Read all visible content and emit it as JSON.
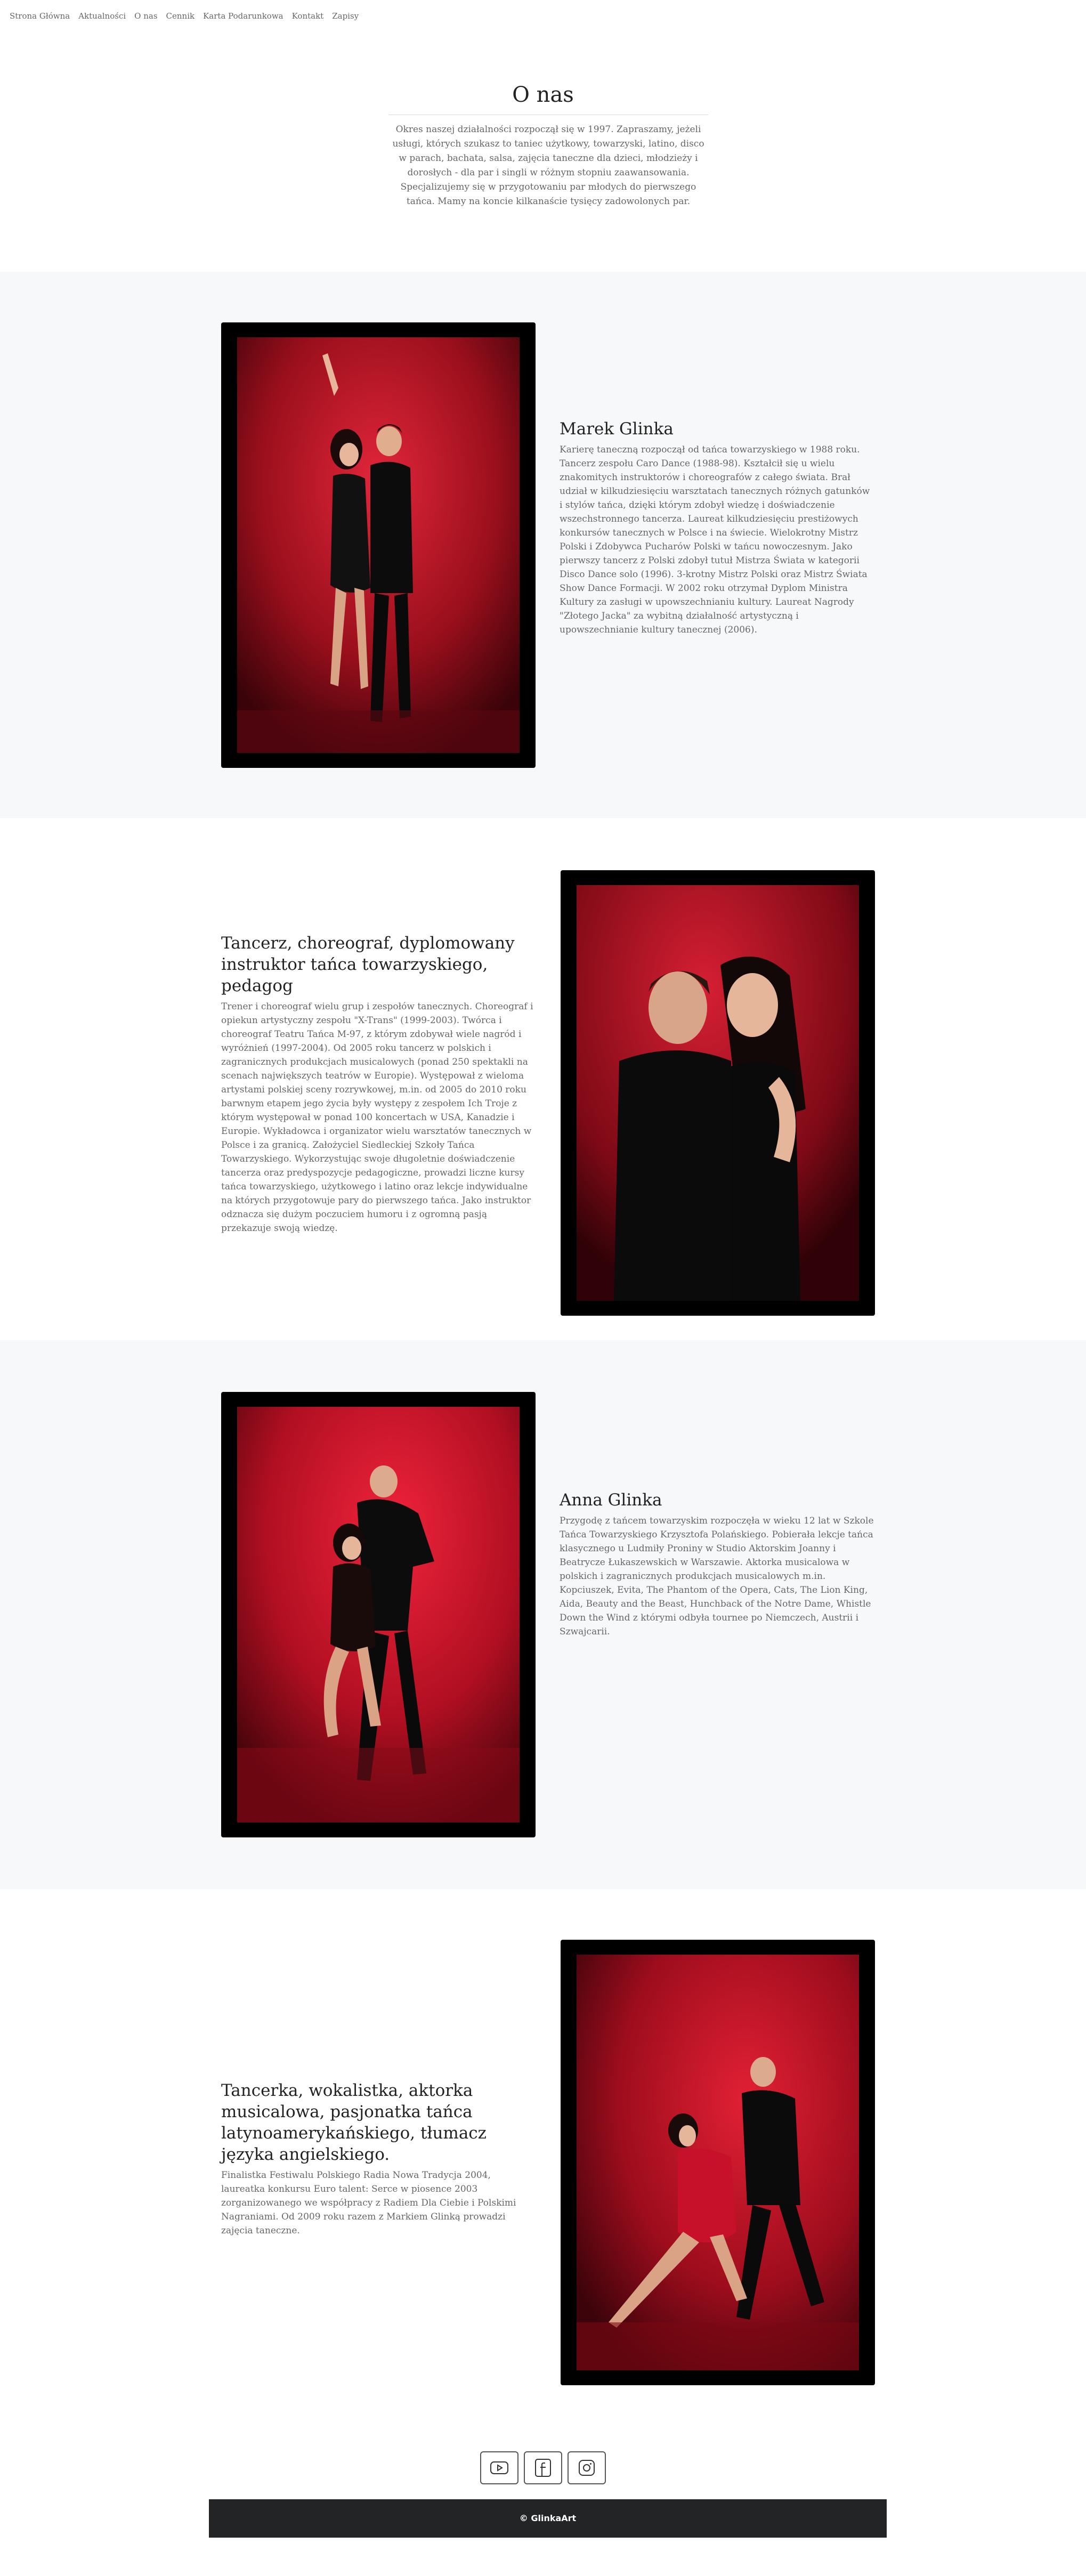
{
  "nav": {
    "items": [
      "Strona Główna",
      "Aktualności",
      "O nas",
      "Cennik",
      "Karta Podarunkowa",
      "Kontakt",
      "Zapisy"
    ]
  },
  "about": {
    "title": "O nas",
    "text": "Okres naszej działalności rozpoczął się w 1997. Zapraszamy, jeżeli usługi, których szukasz to taniec użytkowy, towarzyski, latino, disco w parach, bachata, salsa, zajęcia taneczne dla dzieci, młodzieży i dorosłych - dla par i singli w różnym stopniu zaawansowania. Specjalizujemy się w przygotowaniu par młodych do pierwszego tańca. Mamy na koncie kilkanaście tysięcy zadowolonych par."
  },
  "sections": [
    {
      "heading": "Marek Glinka",
      "text": "Karierę taneczną rozpoczął od tańca towarzyskiego w 1988 roku. Tancerz zespołu Caro Dance (1988-98). Kształcił się u wielu znakomitych instruktorów i choreografów z całego świata. Brał udział w kilkudziesięciu warsztatach tanecznych różnych gatunków i stylów tańca, dzięki którym zdobył wiedzę i doświadczenie wszechstronnego tancerza. Laureat kilkudziesięciu prestiżowych konkursów tanecznych w Polsce i na świecie. Wielokrotny Mistrz Polski i Zdobywca Pucharów Polski w tańcu nowoczesnym. Jako pierwszy tancerz z Polski zdobył tutuł Mistrza Świata w kategorii Disco Dance solo (1996). 3-krotny Mistrz Polski oraz Mistrz Świata Show Dance Formacji. W 2002 roku otrzymał Dyplom Ministra Kultury za zasługi w upowszechnianiu kultury. Laureat Nagrody \"Złotego Jacka\" za wybitną działalność artystyczną i upowszechnianie kultury tanecznej (2006)."
    },
    {
      "heading": "Tancerz, choreograf, dyplomowany instruktor tańca towarzyskiego, pedagog",
      "text": "Trener i choreograf wielu grup i zespołów tanecznych. Choreograf i opiekun artystyczny zespołu \"X-Trans\" (1999-2003). Twórca i choreograf Teatru Tańca M-97, z którym zdobywał wiele nagród i wyróżnień (1997-2004). Od 2005 roku tancerz w polskich i zagranicznych produkcjach musicalowych (ponad 250 spektakli na scenach największych teatrów w Europie). Występował z wieloma artystami polskiej sceny rozrywkowej, m.in. od 2005 do 2010 roku barwnym etapem jego życia były występy z zespołem Ich Troje z którym występował w ponad 100 koncertach w USA, Kanadzie i Europie. Wykładowca i organizator wielu warsztatów tanecznych w Polsce i za granicą. Założyciel Siedleckiej Szkoły Tańca Towarzyskiego. Wykorzystując swoje długoletnie doświadczenie tancerza oraz predyspozycje pedagogiczne, prowadzi liczne kursy tańca towarzyskiego, użytkowego i latino oraz lekcje indywidualne na których przygotowuje pary do pierwszego tańca. Jako instruktor odznacza się dużym poczuciem humoru i z ogromną pasją przekazuje swoją wiedzę."
    },
    {
      "heading": "Anna Glinka",
      "text": "Przygodę z tańcem towarzyskim rozpoczęła w wieku 12 lat w Szkole Tańca Towarzyskiego Krzysztofa Polańskiego. Pobierała lekcje tańca klasycznego u Ludmiły Proniny w Studio Aktorskim Joanny i Beatryczе Łukaszewskich w Warszawie. Aktorka musicalowa w polskich i zagranicznych produkcjach musicalowych m.in. Kopciuszek, Evita, The Phantom of the Opera, Cats, The Lion King, Aida, Beauty and the Beast, Hunchback of the Notre Dame, Whistle Down the Wind z którymi odbyła tournee po Niemczech, Austrii i Szwajcarii."
    },
    {
      "heading": "Tancerka, wokalistka, aktorka musicalowa, pasjonatka tańca latynoamerykańskiego, tłumacz języka angielskiego.",
      "text": "Finalistka Festiwalu Polskiego Radia Nowa Tradycja 2004, laureatka konkursu Euro talent: Serce w piosence 2003 zorganizowanego we współpracy z Radiem Dla Ciebie i Polskimi Nagraniami. Od 2009 roku razem z Markiem Glinką prowadzi zajęcia taneczne."
    }
  ],
  "social": {
    "icons": [
      "youtube-icon",
      "facebook-icon",
      "instagram-icon"
    ]
  },
  "footer": {
    "text": "© GlinkaArt"
  },
  "colors": {
    "band_gray": "#f7f8fa",
    "footer_bg": "#222426",
    "photo_red": "#c1121f"
  }
}
